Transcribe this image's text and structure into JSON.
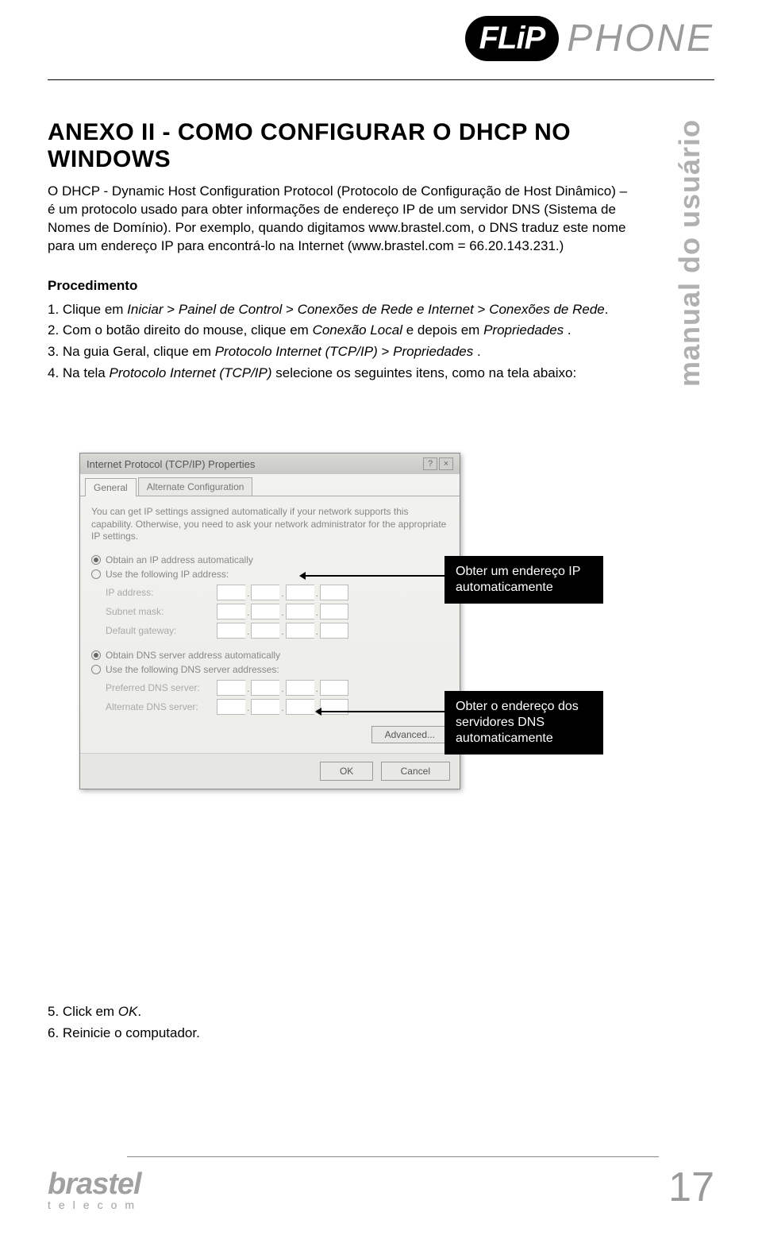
{
  "header": {
    "badge": "FLiP",
    "phone": "PHONE"
  },
  "side_label": "manual do usuário",
  "title": "ANEXO II - COMO CONFIGURAR O DHCP NO WINDOWS",
  "intro": "O DHCP - Dynamic Host Configuration Protocol (Protocolo de Configuração de Host Dinâmico) – é um protocolo usado para obter informações de endereço IP de um servidor DNS (Sistema de Nomes de Domínio). Por exemplo, quando digitamos www.brastel.com, o DNS traduz este nome para um endereço IP para encontrá-lo na Internet (www.brastel.com = 66.20.143.231.)",
  "proc_heading": "Procedimento",
  "steps": {
    "s1_pre": "1. Clique em ",
    "s1_i1": "Iniciar",
    "s1_mid1": " > ",
    "s1_i2": "Painel de Control",
    "s1_mid2": " > ",
    "s1_i3": "Conexões de Rede e Internet",
    "s1_mid3": " > ",
    "s1_i4": "Conexões de Rede",
    "s1_post": ".",
    "s2_pre": "2. Com o botão direito do mouse, clique em ",
    "s2_i1": "Conexão Local",
    "s2_mid": " e depois em ",
    "s2_i2": "Propriedades",
    "s2_post": " .",
    "s3_pre": "3. Na guia Geral, clique em ",
    "s3_i1": "Protocolo Internet (TCP/IP)",
    "s3_mid": " > ",
    "s3_i2": "Propriedades",
    "s3_post": " .",
    "s4_pre": "4. Na tela ",
    "s4_i1": "Protocolo Internet (TCP/IP)",
    "s4_post": " selecione os seguintes itens, como na tela abaixo:"
  },
  "dialog": {
    "title": "Internet Protocol (TCP/IP) Properties",
    "tab1": "General",
    "tab2": "Alternate Configuration",
    "help": "You can get IP settings assigned automatically if your network supports this capability. Otherwise, you need to ask your network administrator for the appropriate IP settings.",
    "r1": "Obtain an IP address automatically",
    "r2": "Use the following IP address:",
    "f_ip": "IP address:",
    "f_mask": "Subnet mask:",
    "f_gw": "Default gateway:",
    "r3": "Obtain DNS server address automatically",
    "r4": "Use the following DNS server addresses:",
    "f_pdns": "Preferred DNS server:",
    "f_adns": "Alternate DNS server:",
    "adv": "Advanced...",
    "ok": "OK",
    "cancel": "Cancel"
  },
  "callouts": {
    "c1": "Obter um endereço IP automaticamente",
    "c2": "Obter o endereço dos servidores DNS automaticamente"
  },
  "footer_steps": {
    "s5_pre": "5. Click em ",
    "s5_i": "OK",
    "s5_post": ".",
    "s6": "6. Reinicie o computador."
  },
  "brand": {
    "name": "brastel",
    "sub": "telecom"
  },
  "page": "17"
}
